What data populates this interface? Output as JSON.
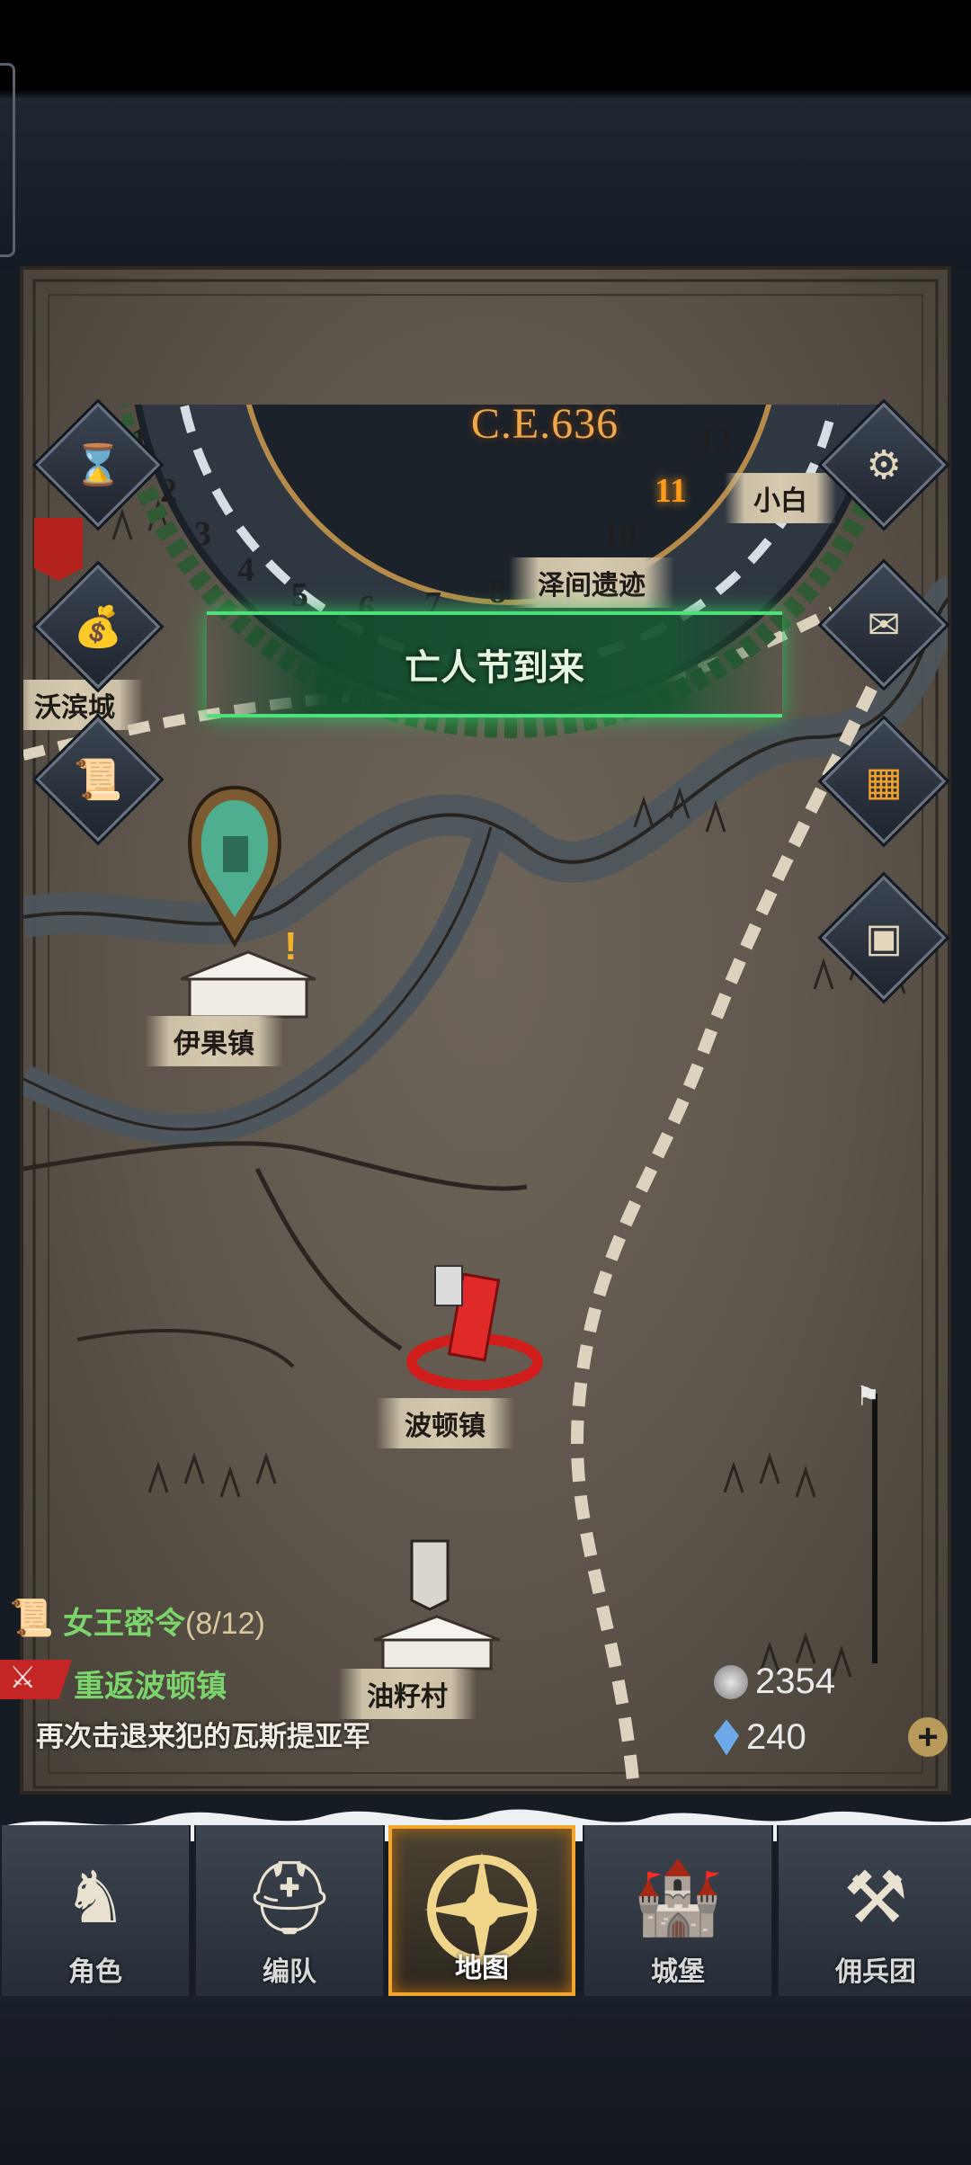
{
  "calendar": {
    "year": "C.E.636",
    "months": [
      "1",
      "2",
      "3",
      "4",
      "5",
      "6",
      "7",
      "8",
      "9",
      "10",
      "11",
      "12"
    ],
    "current_month": "11"
  },
  "event": {
    "title": "亡人节到来"
  },
  "places": {
    "xiaobai": "小白",
    "zejian": "泽间遗迹",
    "woyan": "沃滨城",
    "yiguo": "伊果镇",
    "boton": "波顿镇",
    "youzi": "油籽村"
  },
  "quest": {
    "title": "女王密令",
    "progress": "(8/12)",
    "subtitle": "重返波顿镇",
    "description": "再次击退来犯的瓦斯提亚军"
  },
  "resources": {
    "silver": "2354",
    "crystal": "240"
  },
  "side_buttons": [
    "hourglass-icon",
    "money-bag-icon",
    "scroll-icon",
    "gear-icon",
    "mail-icon",
    "board-icon",
    "supplies-icon"
  ],
  "nav": [
    {
      "id": "role",
      "label": "角色"
    },
    {
      "id": "team",
      "label": "编队"
    },
    {
      "id": "map",
      "label": "地图",
      "active": true
    },
    {
      "id": "castle",
      "label": "城堡"
    },
    {
      "id": "merc",
      "label": "佣兵团"
    }
  ],
  "colors": {
    "accent": "#f2a62b",
    "quest_green": "#7ad56a",
    "event_green": "#4ee07a"
  }
}
